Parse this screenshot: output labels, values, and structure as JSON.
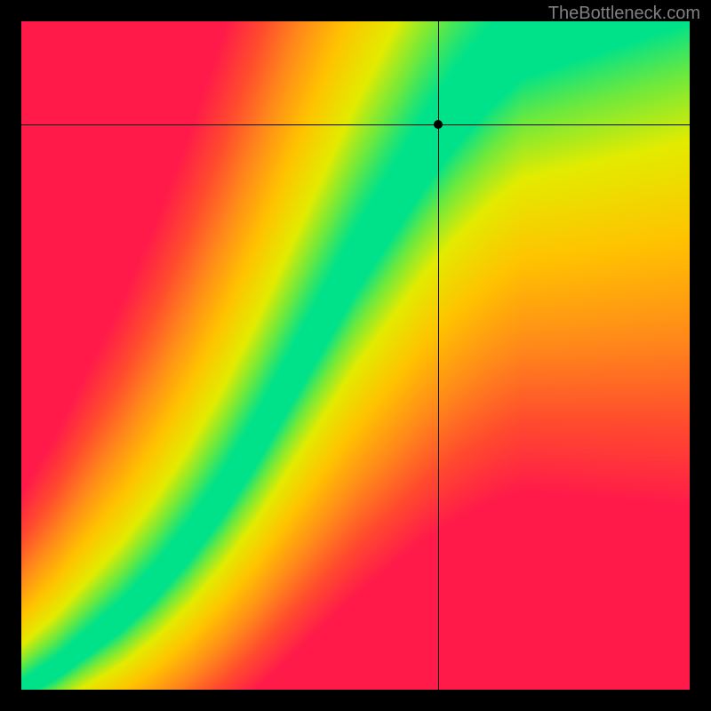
{
  "watermark": "TheBottleneck.com",
  "chart_data": {
    "type": "heatmap",
    "title": "",
    "xlabel": "",
    "ylabel": "",
    "xlim": [
      0,
      1
    ],
    "ylim": [
      0,
      1
    ],
    "crosshair": {
      "x": 0.625,
      "y": 0.845
    },
    "marker": {
      "x": 0.625,
      "y": 0.845
    },
    "optimal_curve": [
      {
        "x": 0.0,
        "y": 0.0
      },
      {
        "x": 0.05,
        "y": 0.03
      },
      {
        "x": 0.1,
        "y": 0.07
      },
      {
        "x": 0.15,
        "y": 0.11
      },
      {
        "x": 0.2,
        "y": 0.16
      },
      {
        "x": 0.25,
        "y": 0.22
      },
      {
        "x": 0.3,
        "y": 0.29
      },
      {
        "x": 0.35,
        "y": 0.37
      },
      {
        "x": 0.4,
        "y": 0.46
      },
      {
        "x": 0.45,
        "y": 0.55
      },
      {
        "x": 0.5,
        "y": 0.64
      },
      {
        "x": 0.55,
        "y": 0.72
      },
      {
        "x": 0.6,
        "y": 0.8
      },
      {
        "x": 0.65,
        "y": 0.87
      },
      {
        "x": 0.7,
        "y": 0.93
      },
      {
        "x": 0.75,
        "y": 0.98
      },
      {
        "x": 0.8,
        "y": 1.0
      }
    ],
    "color_stops": [
      {
        "t": 0.0,
        "color": "#00E28A"
      },
      {
        "t": 0.1,
        "color": "#6FE93C"
      },
      {
        "t": 0.22,
        "color": "#E3EB00"
      },
      {
        "t": 0.4,
        "color": "#FFC300"
      },
      {
        "t": 0.6,
        "color": "#FF8A1A"
      },
      {
        "t": 0.8,
        "color": "#FF4A2E"
      },
      {
        "t": 1.0,
        "color": "#FF1A4A"
      }
    ],
    "grid": false,
    "legend": false
  }
}
